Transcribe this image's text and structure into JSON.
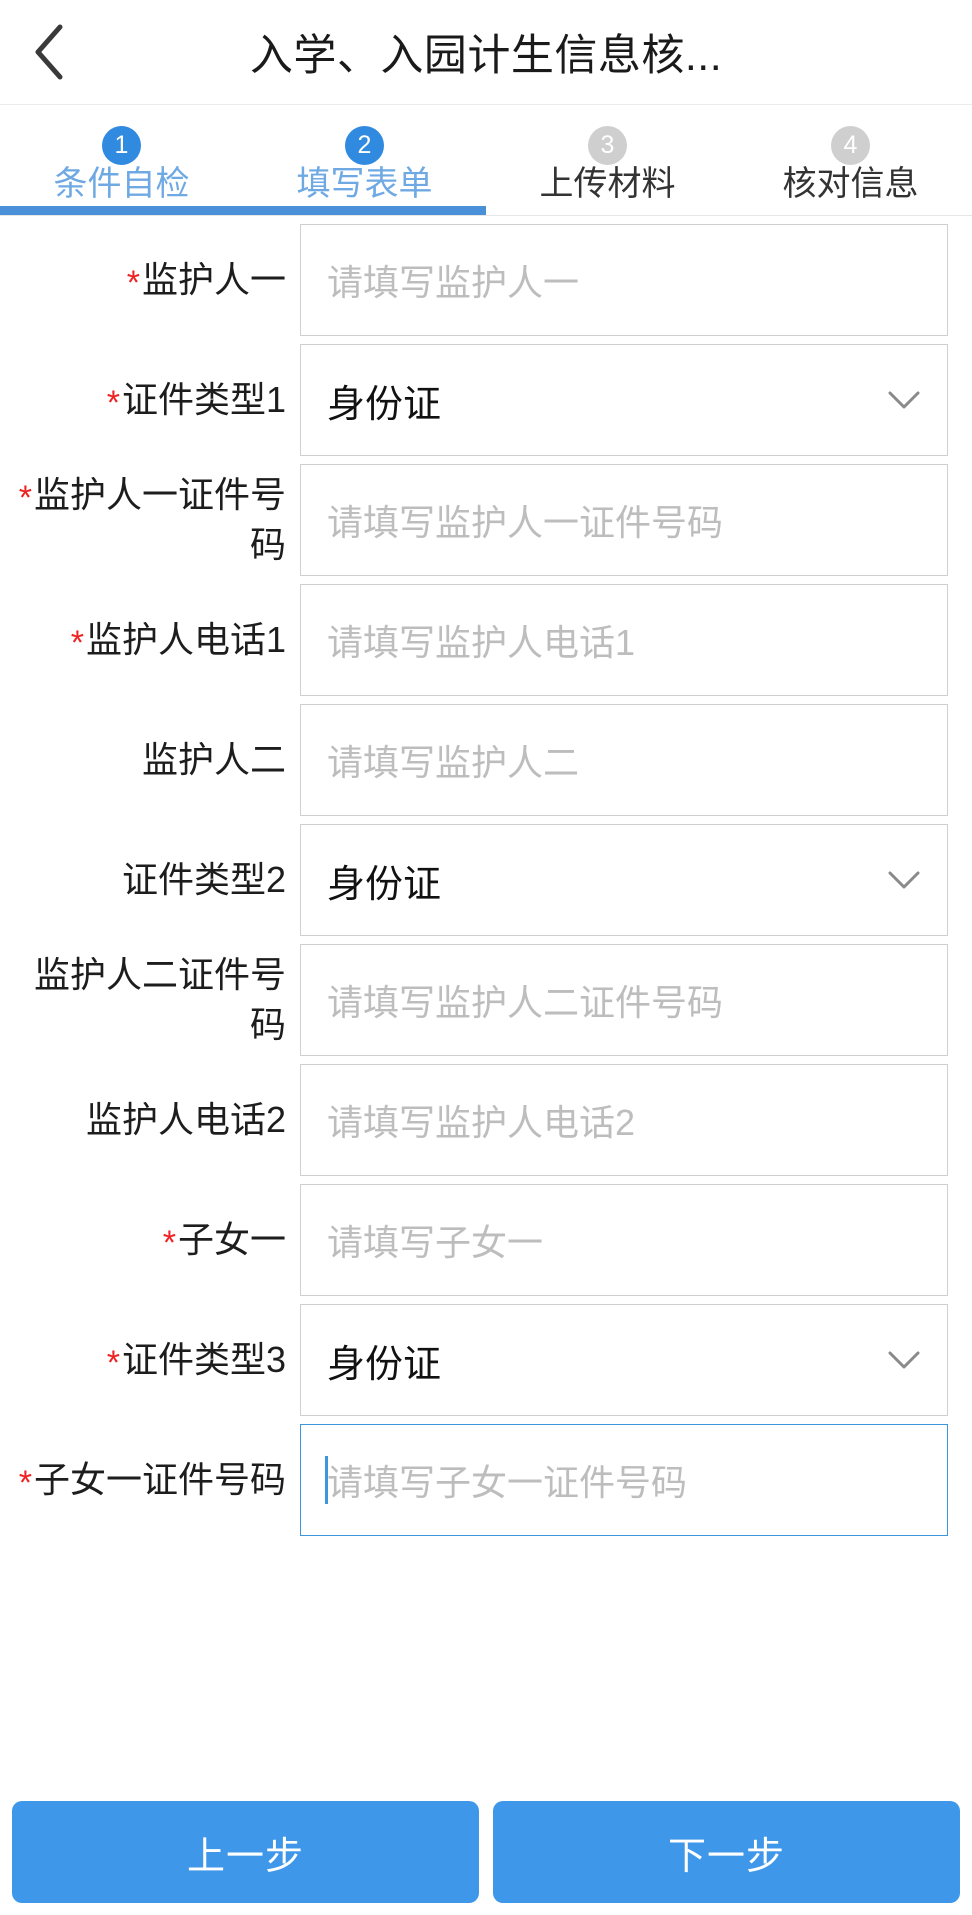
{
  "header": {
    "back_icon": "chevron-left-icon",
    "title": "入学、入园计生信息核..."
  },
  "steps": [
    {
      "number": "1",
      "label": "条件自检",
      "state": "active"
    },
    {
      "number": "2",
      "label": "填写表单",
      "state": "active"
    },
    {
      "number": "3",
      "label": "上传材料",
      "state": "idle"
    },
    {
      "number": "4",
      "label": "核对信息",
      "state": "idle"
    }
  ],
  "form": {
    "fields": [
      {
        "label": "监护人一",
        "required": true,
        "type": "text",
        "placeholder": "请填写监护人一",
        "value": "",
        "focused": false
      },
      {
        "label": "证件类型1",
        "required": true,
        "type": "select",
        "placeholder": "",
        "value": "身份证",
        "focused": false
      },
      {
        "label": "监护人一证件号码",
        "required": true,
        "type": "text",
        "placeholder": "请填写监护人一证件号码",
        "value": "",
        "focused": false
      },
      {
        "label": "监护人电话1",
        "required": true,
        "type": "text",
        "placeholder": "请填写监护人电话1",
        "value": "",
        "focused": false
      },
      {
        "label": "监护人二",
        "required": false,
        "type": "text",
        "placeholder": "请填写监护人二",
        "value": "",
        "focused": false
      },
      {
        "label": "证件类型2",
        "required": false,
        "type": "select",
        "placeholder": "",
        "value": "身份证",
        "focused": false
      },
      {
        "label": "监护人二证件号码",
        "required": false,
        "type": "text",
        "placeholder": "请填写监护人二证件号码",
        "value": "",
        "focused": false
      },
      {
        "label": "监护人电话2",
        "required": false,
        "type": "text",
        "placeholder": "请填写监护人电话2",
        "value": "",
        "focused": false
      },
      {
        "label": "子女一",
        "required": true,
        "type": "text",
        "placeholder": "请填写子女一",
        "value": "",
        "focused": false
      },
      {
        "label": "证件类型3",
        "required": true,
        "type": "select",
        "placeholder": "",
        "value": "身份证",
        "focused": false
      },
      {
        "label": "子女一证件号码",
        "required": true,
        "type": "text",
        "placeholder": "请填写子女一证件号码",
        "value": "",
        "focused": true
      }
    ]
  },
  "footer": {
    "prev_label": "上一步",
    "next_label": "下一步"
  },
  "colors": {
    "accent": "#3e97e8",
    "step_active_badge": "#2f8ae0",
    "step_active_label": "#6fa9e3",
    "step_idle_badge": "#cfcfcf",
    "required_star": "#ee2222",
    "field_border": "#cfcfcf",
    "field_border_focus": "#3e97dd",
    "placeholder": "#bdbdbd"
  }
}
